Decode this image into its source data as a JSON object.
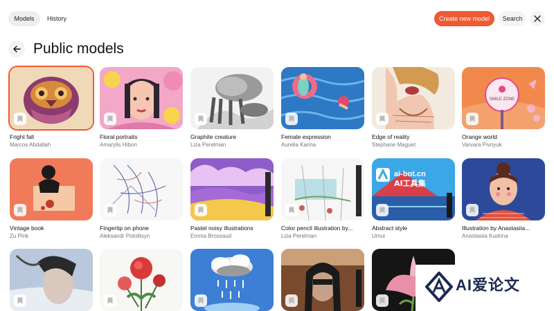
{
  "header": {
    "tabs": [
      {
        "label": "Models",
        "active": true
      },
      {
        "label": "History",
        "active": false
      }
    ],
    "create_label": "Create new model",
    "search_label": "Search",
    "accent_color": "#ef5a32"
  },
  "page": {
    "title": "Public models"
  },
  "cards": [
    {
      "name": "Fright fall",
      "author": "Marcos Abdallah",
      "art": "fright",
      "selected": true
    },
    {
      "name": "Floral portraits",
      "author": "Amarylis Hibon",
      "art": "floral"
    },
    {
      "name": "Graphite creature",
      "author": "Liza Perelman",
      "art": "graphite"
    },
    {
      "name": "Female expression",
      "author": "Aurelia Karina",
      "art": "female"
    },
    {
      "name": "Edge of reality",
      "author": "Stephane Maguet",
      "art": "edge"
    },
    {
      "name": "Orange world",
      "author": "Varvara Pivnyuk",
      "art": "orange",
      "overlay_text": "SMILE ZONE"
    },
    {
      "name": "Vintage book",
      "author": "Zu Pink",
      "art": "vintage"
    },
    {
      "name": "Fingertip on phone",
      "author": "Aleksandr Potolitsyn",
      "art": "finger"
    },
    {
      "name": "Pastel noisy illustrations",
      "author": "Emma Brossaud",
      "art": "pastel"
    },
    {
      "name": "Color pencil illustration by...",
      "author": "Liza Perelman",
      "art": "pencil"
    },
    {
      "name": "Abstract style",
      "author": "Umut",
      "art": "abstract",
      "overlay_text": "ai-bot.cn",
      "overlay_text_2": "AI工具集"
    },
    {
      "name": "Illustration by Anastasiia...",
      "author": "Anastasiia Kudrina",
      "art": "illus"
    },
    {
      "name": "",
      "author": "",
      "art": "r3a"
    },
    {
      "name": "",
      "author": "",
      "art": "r3b"
    },
    {
      "name": "",
      "author": "",
      "art": "r3c"
    },
    {
      "name": "",
      "author": "",
      "art": "r3d"
    },
    {
      "name": "",
      "author": "",
      "art": "r3e"
    }
  ],
  "watermark": {
    "text": "AI爱论文"
  }
}
